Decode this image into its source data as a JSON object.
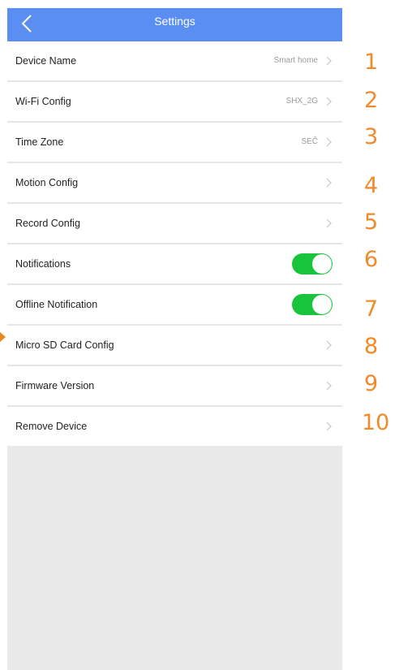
{
  "header": {
    "title": "Settings",
    "back_icon": "chevron-left-icon"
  },
  "rows": [
    {
      "label": "Device Name",
      "value": "Smart home"
    },
    {
      "label": "Wi-Fi Config",
      "value": "SHX_2G"
    },
    {
      "label": "Time Zone",
      "value": "SEČ"
    },
    {
      "label": "Motion Config",
      "value": ""
    },
    {
      "label": "Record Config",
      "value": ""
    },
    {
      "label": "Notifications",
      "toggle": "on"
    },
    {
      "label": "Offline Notification",
      "toggle": "on"
    },
    {
      "label": "Micro SD Card Config",
      "value": ""
    },
    {
      "label": "Firmware Version",
      "value": ""
    },
    {
      "label": "Remove Device",
      "value": ""
    }
  ],
  "annotations": [
    "1",
    "2",
    "3",
    "4",
    "5",
    "6",
    "7",
    "8",
    "9",
    "10"
  ],
  "colors": {
    "header": "#5b8ef2",
    "toggle_on": "#19c33c",
    "annotation": "#f08a2a",
    "background": "#e9e9e9"
  }
}
